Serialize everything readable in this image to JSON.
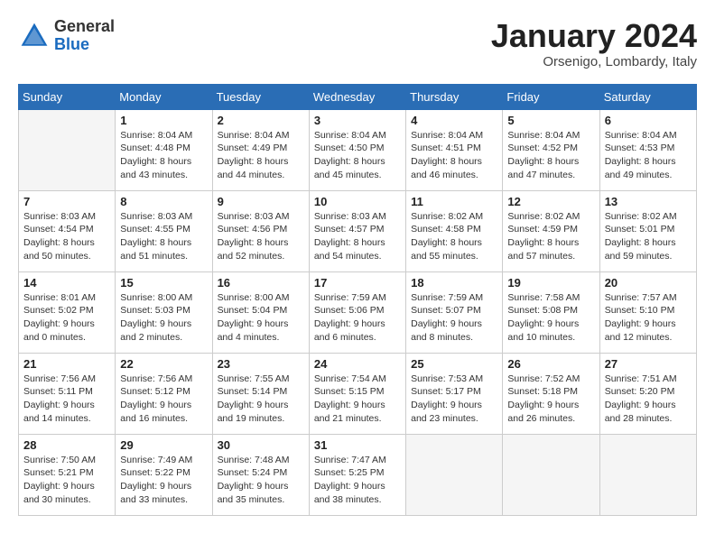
{
  "header": {
    "logo_general": "General",
    "logo_blue": "Blue",
    "month_title": "January 2024",
    "subtitle": "Orsenigo, Lombardy, Italy"
  },
  "days_of_week": [
    "Sunday",
    "Monday",
    "Tuesday",
    "Wednesday",
    "Thursday",
    "Friday",
    "Saturday"
  ],
  "weeks": [
    [
      {
        "day": "",
        "sunrise": "",
        "sunset": "",
        "daylight": ""
      },
      {
        "day": "1",
        "sunrise": "Sunrise: 8:04 AM",
        "sunset": "Sunset: 4:48 PM",
        "daylight": "Daylight: 8 hours and 43 minutes."
      },
      {
        "day": "2",
        "sunrise": "Sunrise: 8:04 AM",
        "sunset": "Sunset: 4:49 PM",
        "daylight": "Daylight: 8 hours and 44 minutes."
      },
      {
        "day": "3",
        "sunrise": "Sunrise: 8:04 AM",
        "sunset": "Sunset: 4:50 PM",
        "daylight": "Daylight: 8 hours and 45 minutes."
      },
      {
        "day": "4",
        "sunrise": "Sunrise: 8:04 AM",
        "sunset": "Sunset: 4:51 PM",
        "daylight": "Daylight: 8 hours and 46 minutes."
      },
      {
        "day": "5",
        "sunrise": "Sunrise: 8:04 AM",
        "sunset": "Sunset: 4:52 PM",
        "daylight": "Daylight: 8 hours and 47 minutes."
      },
      {
        "day": "6",
        "sunrise": "Sunrise: 8:04 AM",
        "sunset": "Sunset: 4:53 PM",
        "daylight": "Daylight: 8 hours and 49 minutes."
      }
    ],
    [
      {
        "day": "7",
        "sunrise": "Sunrise: 8:03 AM",
        "sunset": "Sunset: 4:54 PM",
        "daylight": "Daylight: 8 hours and 50 minutes."
      },
      {
        "day": "8",
        "sunrise": "Sunrise: 8:03 AM",
        "sunset": "Sunset: 4:55 PM",
        "daylight": "Daylight: 8 hours and 51 minutes."
      },
      {
        "day": "9",
        "sunrise": "Sunrise: 8:03 AM",
        "sunset": "Sunset: 4:56 PM",
        "daylight": "Daylight: 8 hours and 52 minutes."
      },
      {
        "day": "10",
        "sunrise": "Sunrise: 8:03 AM",
        "sunset": "Sunset: 4:57 PM",
        "daylight": "Daylight: 8 hours and 54 minutes."
      },
      {
        "day": "11",
        "sunrise": "Sunrise: 8:02 AM",
        "sunset": "Sunset: 4:58 PM",
        "daylight": "Daylight: 8 hours and 55 minutes."
      },
      {
        "day": "12",
        "sunrise": "Sunrise: 8:02 AM",
        "sunset": "Sunset: 4:59 PM",
        "daylight": "Daylight: 8 hours and 57 minutes."
      },
      {
        "day": "13",
        "sunrise": "Sunrise: 8:02 AM",
        "sunset": "Sunset: 5:01 PM",
        "daylight": "Daylight: 8 hours and 59 minutes."
      }
    ],
    [
      {
        "day": "14",
        "sunrise": "Sunrise: 8:01 AM",
        "sunset": "Sunset: 5:02 PM",
        "daylight": "Daylight: 9 hours and 0 minutes."
      },
      {
        "day": "15",
        "sunrise": "Sunrise: 8:00 AM",
        "sunset": "Sunset: 5:03 PM",
        "daylight": "Daylight: 9 hours and 2 minutes."
      },
      {
        "day": "16",
        "sunrise": "Sunrise: 8:00 AM",
        "sunset": "Sunset: 5:04 PM",
        "daylight": "Daylight: 9 hours and 4 minutes."
      },
      {
        "day": "17",
        "sunrise": "Sunrise: 7:59 AM",
        "sunset": "Sunset: 5:06 PM",
        "daylight": "Daylight: 9 hours and 6 minutes."
      },
      {
        "day": "18",
        "sunrise": "Sunrise: 7:59 AM",
        "sunset": "Sunset: 5:07 PM",
        "daylight": "Daylight: 9 hours and 8 minutes."
      },
      {
        "day": "19",
        "sunrise": "Sunrise: 7:58 AM",
        "sunset": "Sunset: 5:08 PM",
        "daylight": "Daylight: 9 hours and 10 minutes."
      },
      {
        "day": "20",
        "sunrise": "Sunrise: 7:57 AM",
        "sunset": "Sunset: 5:10 PM",
        "daylight": "Daylight: 9 hours and 12 minutes."
      }
    ],
    [
      {
        "day": "21",
        "sunrise": "Sunrise: 7:56 AM",
        "sunset": "Sunset: 5:11 PM",
        "daylight": "Daylight: 9 hours and 14 minutes."
      },
      {
        "day": "22",
        "sunrise": "Sunrise: 7:56 AM",
        "sunset": "Sunset: 5:12 PM",
        "daylight": "Daylight: 9 hours and 16 minutes."
      },
      {
        "day": "23",
        "sunrise": "Sunrise: 7:55 AM",
        "sunset": "Sunset: 5:14 PM",
        "daylight": "Daylight: 9 hours and 19 minutes."
      },
      {
        "day": "24",
        "sunrise": "Sunrise: 7:54 AM",
        "sunset": "Sunset: 5:15 PM",
        "daylight": "Daylight: 9 hours and 21 minutes."
      },
      {
        "day": "25",
        "sunrise": "Sunrise: 7:53 AM",
        "sunset": "Sunset: 5:17 PM",
        "daylight": "Daylight: 9 hours and 23 minutes."
      },
      {
        "day": "26",
        "sunrise": "Sunrise: 7:52 AM",
        "sunset": "Sunset: 5:18 PM",
        "daylight": "Daylight: 9 hours and 26 minutes."
      },
      {
        "day": "27",
        "sunrise": "Sunrise: 7:51 AM",
        "sunset": "Sunset: 5:20 PM",
        "daylight": "Daylight: 9 hours and 28 minutes."
      }
    ],
    [
      {
        "day": "28",
        "sunrise": "Sunrise: 7:50 AM",
        "sunset": "Sunset: 5:21 PM",
        "daylight": "Daylight: 9 hours and 30 minutes."
      },
      {
        "day": "29",
        "sunrise": "Sunrise: 7:49 AM",
        "sunset": "Sunset: 5:22 PM",
        "daylight": "Daylight: 9 hours and 33 minutes."
      },
      {
        "day": "30",
        "sunrise": "Sunrise: 7:48 AM",
        "sunset": "Sunset: 5:24 PM",
        "daylight": "Daylight: 9 hours and 35 minutes."
      },
      {
        "day": "31",
        "sunrise": "Sunrise: 7:47 AM",
        "sunset": "Sunset: 5:25 PM",
        "daylight": "Daylight: 9 hours and 38 minutes."
      },
      {
        "day": "",
        "sunrise": "",
        "sunset": "",
        "daylight": ""
      },
      {
        "day": "",
        "sunrise": "",
        "sunset": "",
        "daylight": ""
      },
      {
        "day": "",
        "sunrise": "",
        "sunset": "",
        "daylight": ""
      }
    ]
  ]
}
